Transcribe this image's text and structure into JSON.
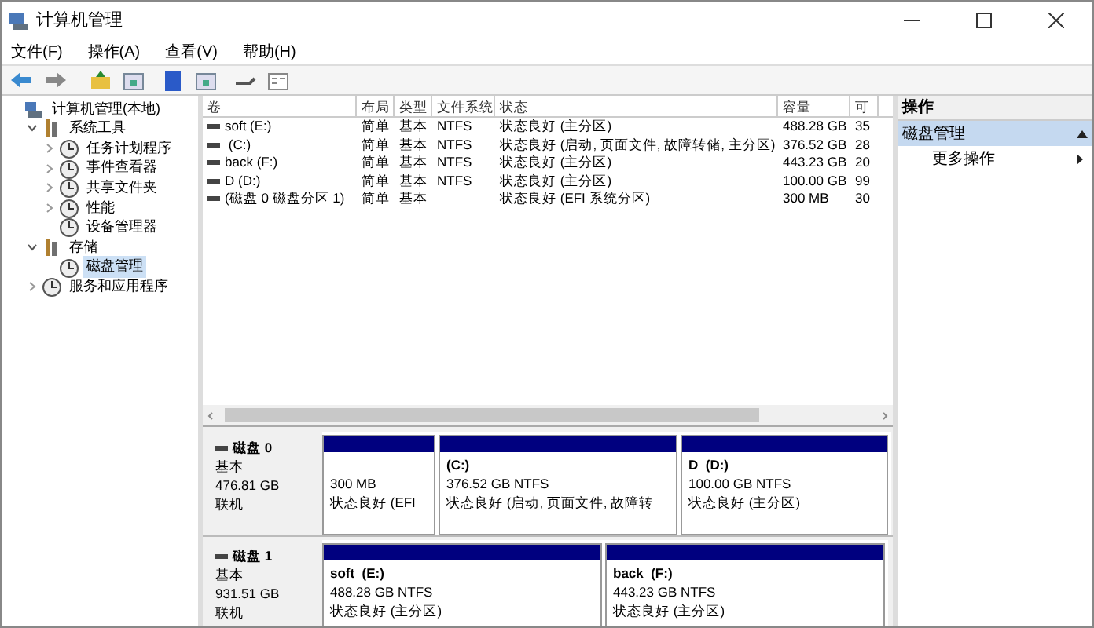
{
  "window": {
    "title": "计算机管理"
  },
  "menu": [
    "文件(F)",
    "操作(A)",
    "查看(V)",
    "帮助(H)"
  ],
  "tree": [
    {
      "label": "计算机管理(本地)",
      "expandable": false,
      "selected": false,
      "children": [
        {
          "label": "系统工具",
          "expandable": true,
          "expanded": true,
          "selected": false,
          "children": [
            {
              "label": "任务计划程序",
              "expandable": true,
              "expanded": false,
              "selected": false
            },
            {
              "label": "事件查看器",
              "expandable": true,
              "expanded": false,
              "selected": false
            },
            {
              "label": "共享文件夹",
              "expandable": true,
              "expanded": false,
              "selected": false
            },
            {
              "label": "性能",
              "expandable": true,
              "expanded": false,
              "selected": false
            },
            {
              "label": "设备管理器",
              "expandable": false,
              "selected": false
            }
          ]
        },
        {
          "label": "存储",
          "expandable": true,
          "expanded": true,
          "selected": false,
          "children": [
            {
              "label": "磁盘管理",
              "expandable": false,
              "selected": true
            }
          ]
        },
        {
          "label": "服务和应用程序",
          "expandable": true,
          "expanded": false,
          "selected": false
        }
      ]
    }
  ],
  "volumes": {
    "columns": [
      "卷",
      "布局",
      "类型",
      "文件系统",
      "状态",
      "容量",
      "可"
    ],
    "rows": [
      [
        "soft (E:)",
        "简单",
        "基本",
        "NTFS",
        "状态良好 (主分区)",
        "488.28 GB",
        "35"
      ],
      [
        " (C:)",
        "简单",
        "基本",
        "NTFS",
        "状态良好 (启动, 页面文件, 故障转储, 主分区)",
        "376.52 GB",
        "28"
      ],
      [
        "back (F:)",
        "简单",
        "基本",
        "NTFS",
        "状态良好 (主分区)",
        "443.23 GB",
        "20"
      ],
      [
        "D (D:)",
        "简单",
        "基本",
        "NTFS",
        "状态良好 (主分区)",
        "100.00 GB",
        "99"
      ],
      [
        "(磁盘 0 磁盘分区 1)",
        "简单",
        "基本",
        "",
        "状态良好 (EFI 系统分区)",
        "300 MB",
        "30"
      ]
    ]
  },
  "disks": [
    {
      "name": "磁盘 0",
      "type": "基本",
      "size": "476.81 GB",
      "status": "联机",
      "partitions": [
        {
          "size": "300 MB",
          "status": "状态良好 (EFI"
        },
        {
          "label": "(C:)",
          "size": "376.52 GB NTFS",
          "status": "状态良好 (启动, 页面文件, 故障转"
        },
        {
          "label": "D  (D:)",
          "size": "100.00 GB NTFS",
          "status": "状态良好 (主分区)"
        }
      ]
    },
    {
      "name": "磁盘 1",
      "type": "基本",
      "size": "931.51 GB",
      "status": "联机",
      "partitions": [
        {
          "label": "soft  (E:)",
          "size": "488.28 GB NTFS",
          "status": "状态良好 (主分区)"
        },
        {
          "label": "back  (F:)",
          "size": "443.23 GB NTFS",
          "status": "状态良好 (主分区)"
        }
      ]
    }
  ],
  "actions": {
    "title": "操作",
    "sections": [
      {
        "label": "磁盘管理",
        "expanded": true,
        "items": [
          "更多操作"
        ]
      }
    ]
  }
}
